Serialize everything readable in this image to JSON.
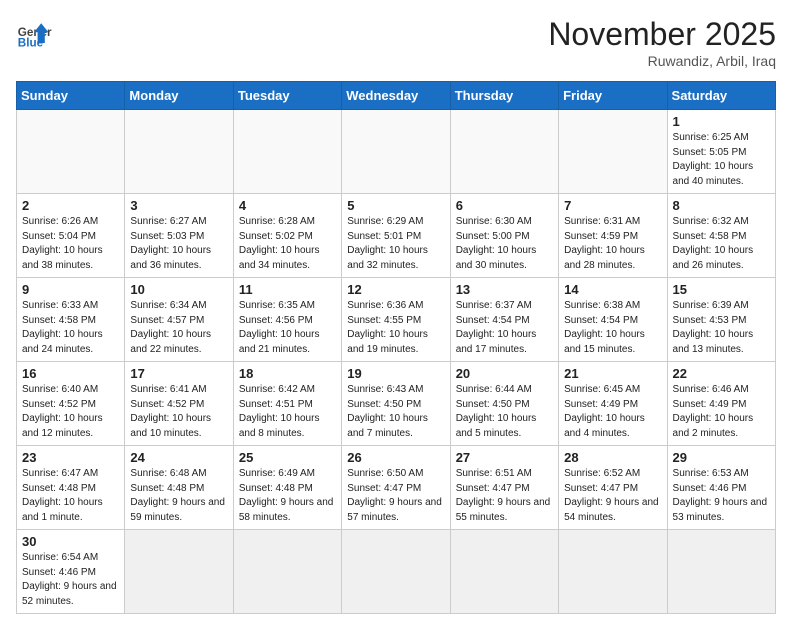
{
  "header": {
    "logo_general": "General",
    "logo_blue": "Blue",
    "month_title": "November 2025",
    "location": "Ruwandiz, Arbil, Iraq"
  },
  "weekdays": [
    "Sunday",
    "Monday",
    "Tuesday",
    "Wednesday",
    "Thursday",
    "Friday",
    "Saturday"
  ],
  "weeks": [
    [
      {
        "day": "",
        "info": ""
      },
      {
        "day": "",
        "info": ""
      },
      {
        "day": "",
        "info": ""
      },
      {
        "day": "",
        "info": ""
      },
      {
        "day": "",
        "info": ""
      },
      {
        "day": "",
        "info": ""
      },
      {
        "day": "1",
        "info": "Sunrise: 6:25 AM\nSunset: 5:05 PM\nDaylight: 10 hours and 40 minutes."
      }
    ],
    [
      {
        "day": "2",
        "info": "Sunrise: 6:26 AM\nSunset: 5:04 PM\nDaylight: 10 hours and 38 minutes."
      },
      {
        "day": "3",
        "info": "Sunrise: 6:27 AM\nSunset: 5:03 PM\nDaylight: 10 hours and 36 minutes."
      },
      {
        "day": "4",
        "info": "Sunrise: 6:28 AM\nSunset: 5:02 PM\nDaylight: 10 hours and 34 minutes."
      },
      {
        "day": "5",
        "info": "Sunrise: 6:29 AM\nSunset: 5:01 PM\nDaylight: 10 hours and 32 minutes."
      },
      {
        "day": "6",
        "info": "Sunrise: 6:30 AM\nSunset: 5:00 PM\nDaylight: 10 hours and 30 minutes."
      },
      {
        "day": "7",
        "info": "Sunrise: 6:31 AM\nSunset: 4:59 PM\nDaylight: 10 hours and 28 minutes."
      },
      {
        "day": "8",
        "info": "Sunrise: 6:32 AM\nSunset: 4:58 PM\nDaylight: 10 hours and 26 minutes."
      }
    ],
    [
      {
        "day": "9",
        "info": "Sunrise: 6:33 AM\nSunset: 4:58 PM\nDaylight: 10 hours and 24 minutes."
      },
      {
        "day": "10",
        "info": "Sunrise: 6:34 AM\nSunset: 4:57 PM\nDaylight: 10 hours and 22 minutes."
      },
      {
        "day": "11",
        "info": "Sunrise: 6:35 AM\nSunset: 4:56 PM\nDaylight: 10 hours and 21 minutes."
      },
      {
        "day": "12",
        "info": "Sunrise: 6:36 AM\nSunset: 4:55 PM\nDaylight: 10 hours and 19 minutes."
      },
      {
        "day": "13",
        "info": "Sunrise: 6:37 AM\nSunset: 4:54 PM\nDaylight: 10 hours and 17 minutes."
      },
      {
        "day": "14",
        "info": "Sunrise: 6:38 AM\nSunset: 4:54 PM\nDaylight: 10 hours and 15 minutes."
      },
      {
        "day": "15",
        "info": "Sunrise: 6:39 AM\nSunset: 4:53 PM\nDaylight: 10 hours and 13 minutes."
      }
    ],
    [
      {
        "day": "16",
        "info": "Sunrise: 6:40 AM\nSunset: 4:52 PM\nDaylight: 10 hours and 12 minutes."
      },
      {
        "day": "17",
        "info": "Sunrise: 6:41 AM\nSunset: 4:52 PM\nDaylight: 10 hours and 10 minutes."
      },
      {
        "day": "18",
        "info": "Sunrise: 6:42 AM\nSunset: 4:51 PM\nDaylight: 10 hours and 8 minutes."
      },
      {
        "day": "19",
        "info": "Sunrise: 6:43 AM\nSunset: 4:50 PM\nDaylight: 10 hours and 7 minutes."
      },
      {
        "day": "20",
        "info": "Sunrise: 6:44 AM\nSunset: 4:50 PM\nDaylight: 10 hours and 5 minutes."
      },
      {
        "day": "21",
        "info": "Sunrise: 6:45 AM\nSunset: 4:49 PM\nDaylight: 10 hours and 4 minutes."
      },
      {
        "day": "22",
        "info": "Sunrise: 6:46 AM\nSunset: 4:49 PM\nDaylight: 10 hours and 2 minutes."
      }
    ],
    [
      {
        "day": "23",
        "info": "Sunrise: 6:47 AM\nSunset: 4:48 PM\nDaylight: 10 hours and 1 minute."
      },
      {
        "day": "24",
        "info": "Sunrise: 6:48 AM\nSunset: 4:48 PM\nDaylight: 9 hours and 59 minutes."
      },
      {
        "day": "25",
        "info": "Sunrise: 6:49 AM\nSunset: 4:48 PM\nDaylight: 9 hours and 58 minutes."
      },
      {
        "day": "26",
        "info": "Sunrise: 6:50 AM\nSunset: 4:47 PM\nDaylight: 9 hours and 57 minutes."
      },
      {
        "day": "27",
        "info": "Sunrise: 6:51 AM\nSunset: 4:47 PM\nDaylight: 9 hours and 55 minutes."
      },
      {
        "day": "28",
        "info": "Sunrise: 6:52 AM\nSunset: 4:47 PM\nDaylight: 9 hours and 54 minutes."
      },
      {
        "day": "29",
        "info": "Sunrise: 6:53 AM\nSunset: 4:46 PM\nDaylight: 9 hours and 53 minutes."
      }
    ],
    [
      {
        "day": "30",
        "info": "Sunrise: 6:54 AM\nSunset: 4:46 PM\nDaylight: 9 hours and 52 minutes."
      },
      {
        "day": "",
        "info": ""
      },
      {
        "day": "",
        "info": ""
      },
      {
        "day": "",
        "info": ""
      },
      {
        "day": "",
        "info": ""
      },
      {
        "day": "",
        "info": ""
      },
      {
        "day": "",
        "info": ""
      }
    ]
  ]
}
